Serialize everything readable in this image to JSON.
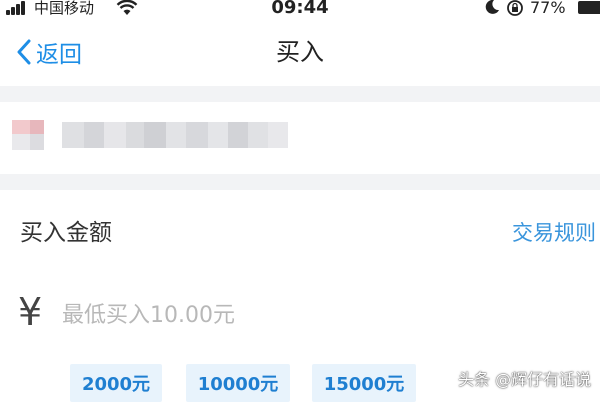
{
  "status_bar": {
    "carrier": "中国移动",
    "time": "09:44",
    "battery": "77%"
  },
  "nav": {
    "back_label": "返回",
    "title": "买入"
  },
  "amount": {
    "label": "买入金额",
    "rules_link": "交易规则",
    "currency_symbol": "¥",
    "placeholder": "最低买入10.00元",
    "value": "",
    "quick_amounts": [
      "2000元",
      "10000元",
      "15000元"
    ]
  },
  "watermark": "头条 @辉仔有话说",
  "colors": {
    "accent": "#1e8ee6",
    "chip_bg": "#e8f3fc",
    "section_gap": "#f2f3f5"
  },
  "icons": [
    "signal-icon",
    "wifi-icon",
    "moon-icon",
    "rotation-lock-icon",
    "battery-icon",
    "chevron-left-icon"
  ]
}
